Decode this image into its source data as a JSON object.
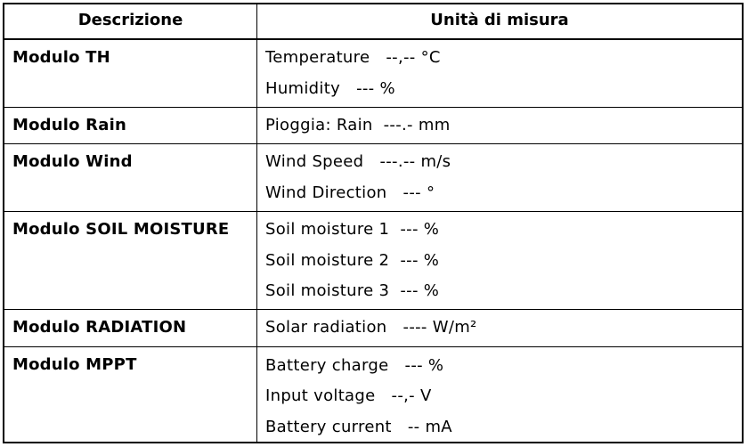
{
  "header": {
    "col1": "Descrizione",
    "col2": "Unità di misura"
  },
  "rows": [
    {
      "module": "Modulo TH",
      "units": [
        "Temperature   --,-- °C",
        "Humidity   --- %"
      ]
    },
    {
      "module": "Modulo Rain",
      "units": [
        "Pioggia: Rain  ---.- mm"
      ]
    },
    {
      "module": "Modulo Wind",
      "units": [
        "Wind Speed   ---.-- m/s",
        "Wind Direction   --- °"
      ]
    },
    {
      "module": "Modulo SOIL MOISTURE",
      "units": [
        "Soil moisture 1  --- %",
        "Soil moisture 2  --- %",
        "Soil moisture 3  --- %"
      ]
    },
    {
      "module": "Modulo RADIATION",
      "units": [
        "Solar radiation   ---- W/m²"
      ]
    },
    {
      "module": "Modulo MPPT",
      "units": [
        "Battery charge   --- %",
        "Input voltage   --,- V",
        "Battery current   -- mA"
      ]
    }
  ]
}
